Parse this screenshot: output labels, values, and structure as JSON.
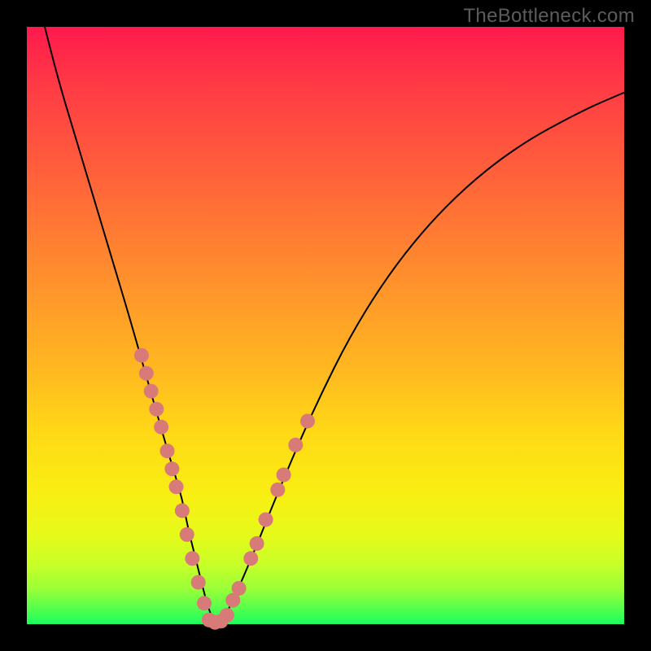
{
  "watermark": "TheBottleneck.com",
  "chart_data": {
    "type": "line",
    "title": "",
    "xlabel": "",
    "ylabel": "",
    "xlim": [
      0,
      100
    ],
    "ylim": [
      0,
      100
    ],
    "grid": false,
    "legend": false,
    "annotations": [],
    "series": [
      {
        "name": "bottleneck-curve",
        "color": "#000000",
        "x": [
          3,
          5,
          8,
          11,
          14,
          17,
          19,
          21,
          23,
          24.5,
          26,
          27,
          28,
          29,
          30,
          31,
          32,
          33,
          35,
          38,
          42,
          48,
          55,
          63,
          72,
          82,
          93,
          100
        ],
        "y": [
          100,
          92,
          82,
          72,
          62,
          52,
          45,
          38,
          31,
          26,
          21,
          16,
          12,
          8,
          4,
          1,
          0,
          1,
          5,
          12,
          22,
          36,
          50,
          62,
          72,
          80,
          86,
          89
        ]
      },
      {
        "name": "highlight-markers-left",
        "color": "#d87a77",
        "marker": "circle",
        "x": [
          19.2,
          20.0,
          20.8,
          21.7,
          22.5,
          23.5,
          24.3,
          25.0,
          26.0,
          26.8,
          27.7,
          28.7,
          29.7
        ],
        "y": [
          45.0,
          42.0,
          39.0,
          36.0,
          33.0,
          29.0,
          26.0,
          23.0,
          19.0,
          15.0,
          11.0,
          7.0,
          3.5
        ]
      },
      {
        "name": "highlight-markers-bottom",
        "color": "#d87a77",
        "marker": "circle",
        "x": [
          30.5,
          31.5,
          32.5,
          33.5
        ],
        "y": [
          0.7,
          0.3,
          0.5,
          1.5
        ]
      },
      {
        "name": "highlight-markers-right",
        "color": "#d87a77",
        "marker": "circle",
        "x": [
          34.5,
          35.5,
          37.5,
          38.5,
          40.0,
          42.0,
          43.0,
          45.0,
          47.0
        ],
        "y": [
          4.0,
          6.0,
          11.0,
          13.5,
          17.5,
          22.5,
          25.0,
          30.0,
          34.0
        ]
      }
    ]
  }
}
